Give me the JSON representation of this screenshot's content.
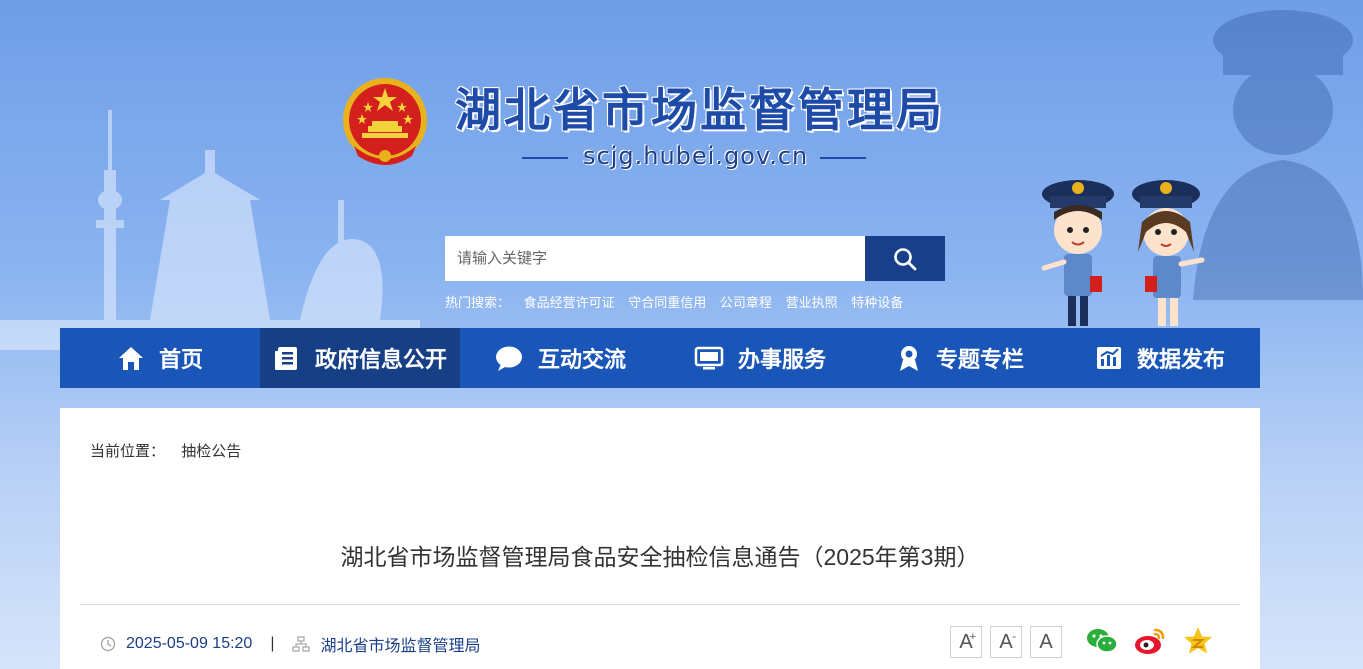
{
  "header": {
    "site_title": "湖北省市场监督管理局",
    "domain": "scjg.hubei.gov.cn"
  },
  "search": {
    "placeholder": "请输入关键字",
    "hot_label": "热门搜索：",
    "hot_items": [
      "食品经营许可证",
      "守合同重信用",
      "公司章程",
      "营业执照",
      "特种设备"
    ]
  },
  "nav": {
    "items": [
      {
        "label": "首页",
        "icon": "home-icon"
      },
      {
        "label": "政府信息公开",
        "icon": "document-icon"
      },
      {
        "label": "互动交流",
        "icon": "chat-icon"
      },
      {
        "label": "办事服务",
        "icon": "monitor-icon"
      },
      {
        "label": "专题专栏",
        "icon": "ribbon-icon"
      },
      {
        "label": "数据发布",
        "icon": "chart-icon"
      }
    ],
    "active_index": 1
  },
  "breadcrumb": {
    "label": "当前位置：",
    "current": "抽检公告"
  },
  "article": {
    "title": "湖北省市场监督管理局食品安全抽检信息通告（2025年第3期）",
    "date": "2025-05-09 15:20",
    "separator": "|",
    "source": "湖北省市场监督管理局"
  },
  "font_controls": {
    "increase": "A",
    "decrease": "A",
    "reset": "A"
  },
  "share": [
    "wechat-icon",
    "weibo-icon",
    "favorite-icon"
  ],
  "colors": {
    "nav_bg": "#1a56b8",
    "nav_active": "#163f86",
    "title_blue": "#1e4aa8",
    "search_btn": "#173f8a"
  }
}
